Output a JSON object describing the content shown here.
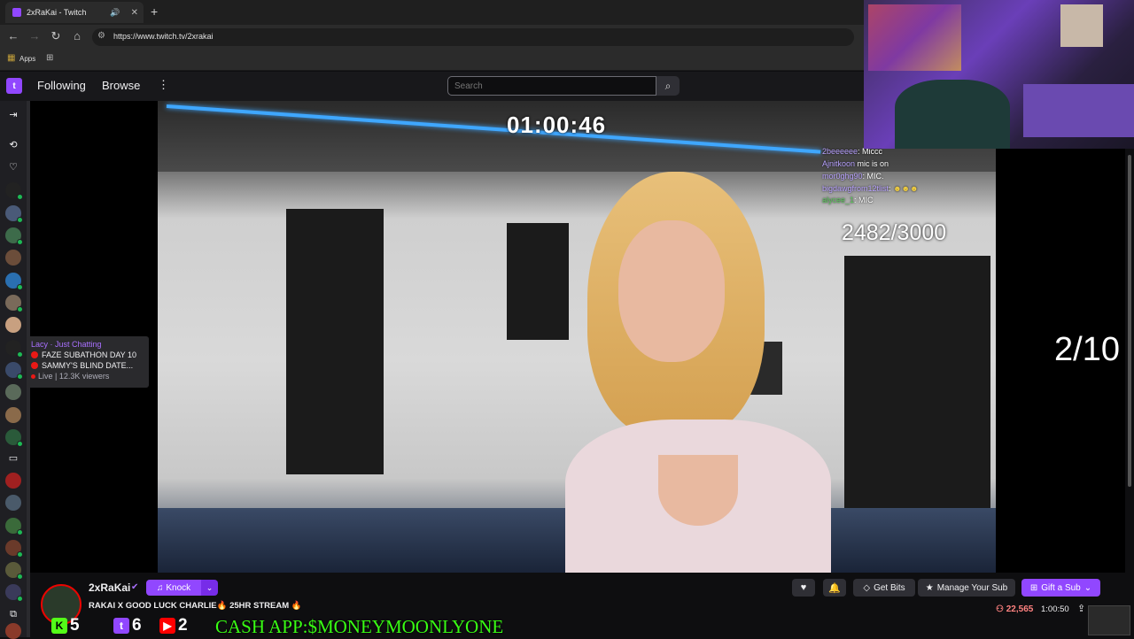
{
  "browser": {
    "tab_title": "2xRaKai - Twitch",
    "url": "https://www.twitch.tv/2xrakai",
    "bookmarks_label": "Apps"
  },
  "nav": {
    "following": "Following",
    "browse": "Browse",
    "search_placeholder": "Search"
  },
  "tooltip": {
    "channel": "Lacy · Just Chatting",
    "line1": "FAZE SUBATHON DAY 10",
    "line2": "SAMMY'S BLIND DATE...",
    "live": "Live | 12.3K viewers"
  },
  "overlay": {
    "timer": "01:00:46",
    "goal": "2482/3000",
    "count": "2/10",
    "cashapp": "CASH APP:$MONEYMOONLYONE",
    "kick_count": "5",
    "twitch_count": "6",
    "youtube_count": "2"
  },
  "chat_overlay": [
    {
      "user": "2beeeeee",
      "msg": ": Miccc"
    },
    {
      "user": "Ajnitkoon",
      "msg": "mic is on"
    },
    {
      "user": "mor0ghg90",
      "msg": ": MIC."
    },
    {
      "user": "bigdawgfrom12tlist",
      "msg": ":"
    },
    {
      "user": "alycee_1",
      "msg": ": MIC"
    }
  ],
  "channel": {
    "name": "2xRaKai",
    "knock_label": "Knock",
    "title": "RAKAI X GOOD LUCK CHARLIE🔥 25HR STREAM 🔥",
    "viewers": "22,565",
    "uptime": "1:00:50"
  },
  "actions": {
    "get_bits": "Get Bits",
    "manage_sub": "Manage Your Sub",
    "gift_sub": "Gift a Sub"
  },
  "colors": {
    "twitch_purple": "#9147ff",
    "live_red": "#e91916",
    "cashapp_green": "#39ff14"
  }
}
